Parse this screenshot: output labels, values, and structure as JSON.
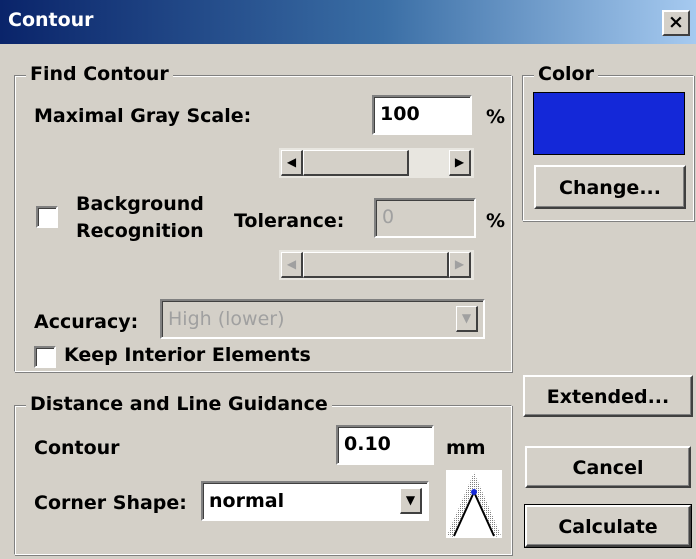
{
  "window": {
    "title": "Contour",
    "close_label": "×"
  },
  "find_contour": {
    "legend": "Find Contour",
    "max_gray_label": "Maximal Gray Scale:",
    "max_gray_value": "100",
    "percent": "%",
    "background_recognition": {
      "line1": "Background",
      "line2": "Recognition",
      "checked": false
    },
    "tolerance_label": "Tolerance:",
    "tolerance_value": "0",
    "accuracy_label": "Accuracy:",
    "accuracy_value": "High (lower)",
    "keep_interior_label": "Keep Interior Elements",
    "keep_interior_checked": false
  },
  "color": {
    "legend": "Color",
    "swatch": "#1428d8",
    "change_label": "Change..."
  },
  "distance": {
    "legend": "Distance and Line Guidance",
    "contour_label": "Contour",
    "contour_value": "0.10",
    "unit": "mm",
    "corner_label": "Corner Shape:",
    "corner_value": "normal"
  },
  "buttons": {
    "extended": "Extended...",
    "cancel": "Cancel",
    "calculate": "Calculate"
  },
  "icons": {
    "close": "close-icon",
    "arrow_left": "◀",
    "arrow_right": "▶",
    "arrow_down": "▼"
  }
}
